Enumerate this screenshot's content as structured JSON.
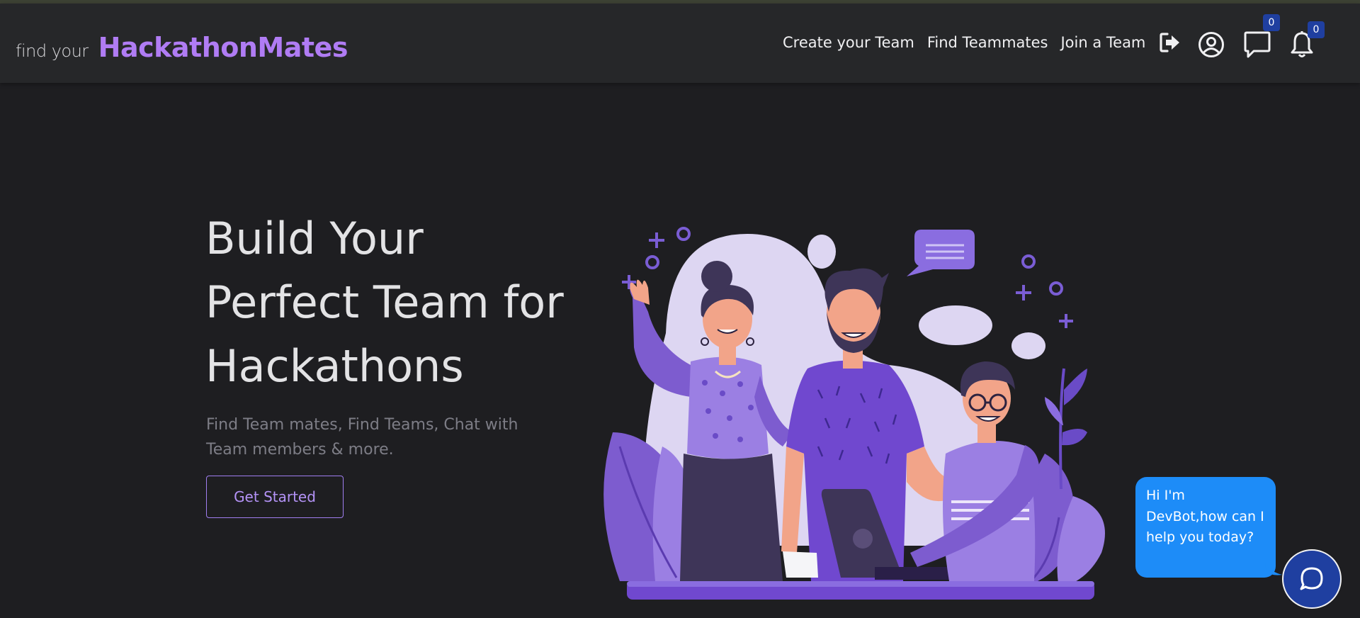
{
  "brand": {
    "prefix": "find your",
    "name": "HackathonMates"
  },
  "nav": {
    "links": [
      "Create your Team",
      "Find Teammates",
      "Join a Team"
    ],
    "icons": [
      "logout-icon",
      "user-circle-icon",
      "message-icon",
      "bell-icon"
    ],
    "message_badge": "0",
    "notification_badge": "0"
  },
  "hero": {
    "title_lines": [
      "Build Your",
      "Perfect Team for",
      "Hackathons"
    ],
    "subtitle": "Find Team mates, Find Teams, Chat with Team members & more.",
    "cta_label": "Get Started"
  },
  "chatbot": {
    "message": "Hi I'm DevBot,how can I help you today?",
    "button_icon": "chat-icon"
  },
  "colors": {
    "background": "#1e1e21",
    "navbar": "#262729",
    "accent": "#b07cf4",
    "chat_bubble": "#1d8cf8",
    "badge": "#1f3fa0"
  }
}
